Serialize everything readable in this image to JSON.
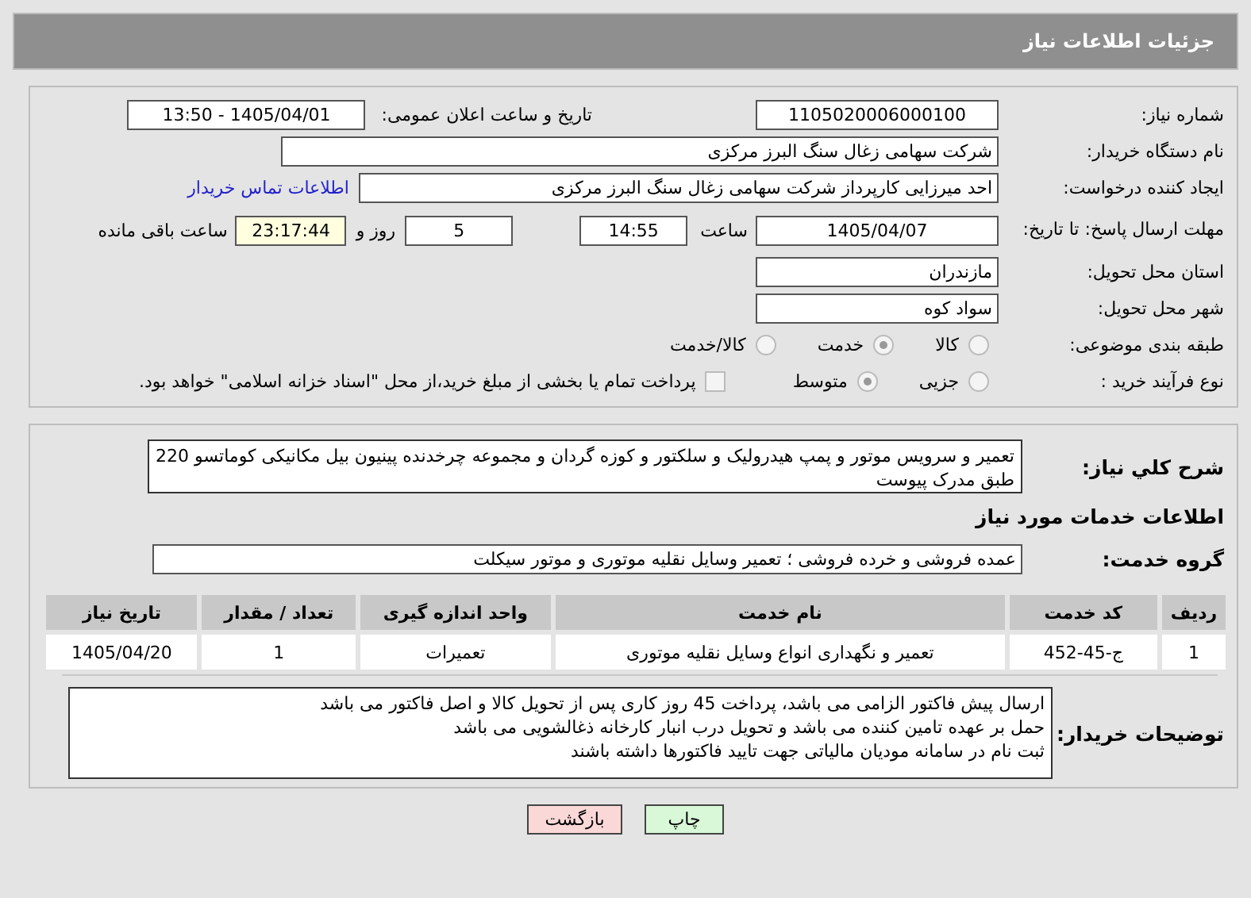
{
  "header": {
    "title": "جزئیات اطلاعات نیاز"
  },
  "need_number": {
    "label": "شماره نیاز:",
    "value": "1105020006000100"
  },
  "announce": {
    "label": "تاریخ و ساعت اعلان عمومی:",
    "value": "1405/04/01 - 13:50"
  },
  "buyer": {
    "label": "نام دستگاه خریدار:",
    "value": "شرکت سهامی زغال سنگ البرز مرکزی"
  },
  "requester": {
    "label": "ایجاد کننده درخواست:",
    "value": "احد میرزایی کارپرداز شرکت سهامی زغال سنگ البرز مرکزی",
    "link": "اطلاعات تماس خریدار"
  },
  "deadline": {
    "label": "مهلت ارسال پاسخ: تا تاریخ:",
    "date": "1405/04/07",
    "time_label": "ساعت",
    "time": "14:55",
    "days": "5",
    "days_label": "روز و",
    "remaining": "23:17:44",
    "remaining_label": "ساعت باقی مانده"
  },
  "province": {
    "label": "استان محل تحویل:",
    "value": "مازندران"
  },
  "city": {
    "label": "شهر محل تحویل:",
    "value": "سواد کوه"
  },
  "category": {
    "label": "طبقه بندی موضوعی:",
    "options": [
      {
        "label": "کالا",
        "selected": false
      },
      {
        "label": "خدمت",
        "selected": true
      },
      {
        "label": "کالا/خدمت",
        "selected": false
      }
    ]
  },
  "process": {
    "label": "نوع فرآیند خرید :",
    "options": [
      {
        "label": "جزیی",
        "selected": false
      },
      {
        "label": "متوسط",
        "selected": true
      }
    ],
    "payment": {
      "label": "پرداخت تمام یا بخشی از مبلغ خرید،از محل \"اسناد خزانه اسلامی\" خواهد بود.",
      "checked": false
    }
  },
  "description": {
    "label": "شرح کلي نياز:",
    "value": "تعمیر و سرویس موتور و پمپ هیدرولیک و سلکتور و کوزه گردان و مجموعه چرخدنده پینیون بیل مکانیکی کوماتسو 220 طبق مدرک پیوست"
  },
  "services_heading": "اطلاعات خدمات مورد نیاز",
  "service_group": {
    "label": "گروه خدمت:",
    "value": "عمده فروشی و خرده فروشی ؛ تعمیر وسایل نقلیه موتوری و موتور سیکلت"
  },
  "table": {
    "columns": [
      "ردیف",
      "کد خدمت",
      "نام خدمت",
      "واحد اندازه گیری",
      "تعداد / مقدار",
      "تاریخ نیاز"
    ],
    "rows": [
      [
        "1",
        "ج-45-452",
        "تعمیر و نگهداری انواع وسایل نقلیه موتوری",
        "تعمیرات",
        "1",
        "1405/04/20"
      ]
    ]
  },
  "buyer_notes": {
    "label": "توضیحات خریدار:",
    "lines": [
      "ارسال پیش فاکتور الزامی می باشد، پرداخت 45 روز کاری پس از تحویل کالا و اصل فاکتور می باشد",
      "حمل بر عهده تامین کننده می باشد و تحویل درب انبار کارخانه ذغالشویی می باشد",
      "ثبت نام در سامانه مودیان مالیاتی جهت تایید فاکتورها داشته باشند"
    ]
  },
  "buttons": [
    {
      "label": "چاپ",
      "kind": "print"
    },
    {
      "label": "بازگشت",
      "kind": "back"
    }
  ]
}
